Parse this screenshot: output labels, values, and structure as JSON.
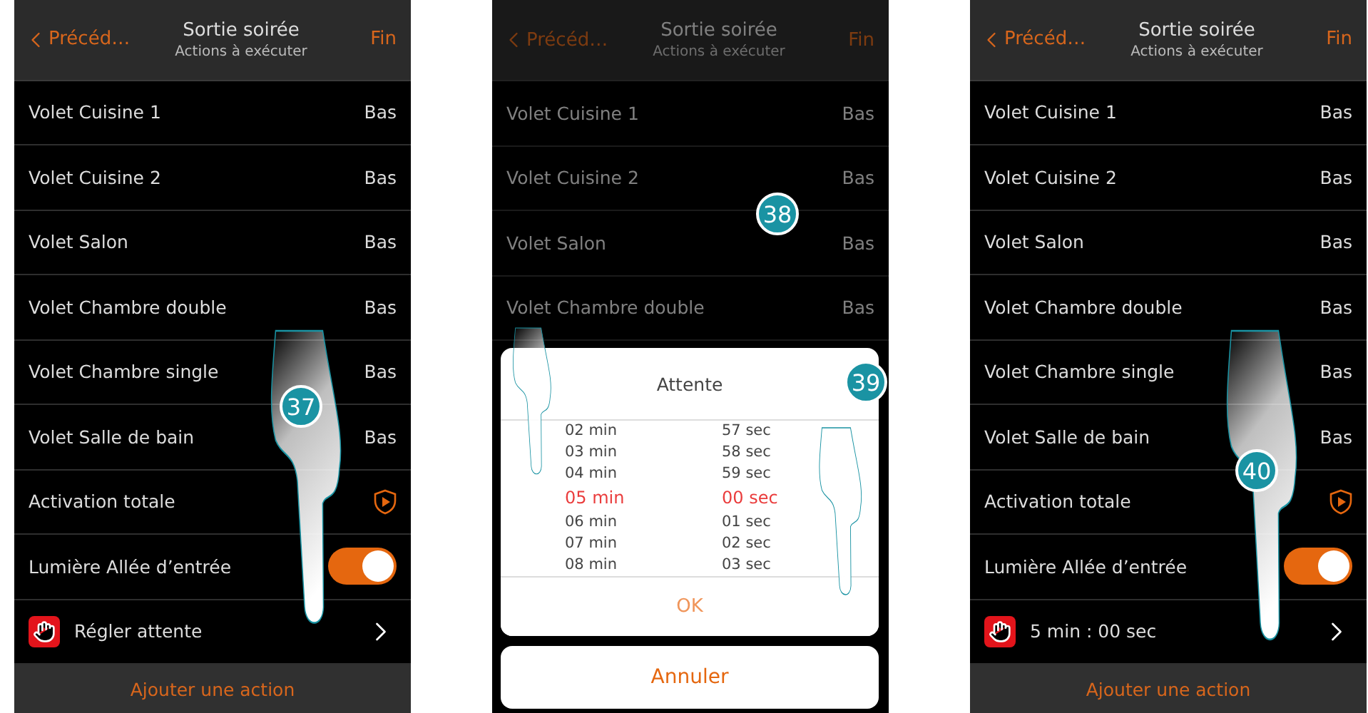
{
  "screens": [
    {
      "header": {
        "back": "Précéd…",
        "title": "Sortie soirée",
        "subtitle": "Actions à exécuter",
        "action": "Fin"
      },
      "dimmed": false,
      "steps": [
        {
          "label": "37"
        }
      ],
      "rows": [
        {
          "kind": "value",
          "label": "Volet Cuisine 1",
          "value": "Bas"
        },
        {
          "kind": "value",
          "label": "Volet Cuisine 2",
          "value": "Bas"
        },
        {
          "kind": "value",
          "label": "Volet Salon",
          "value": "Bas"
        },
        {
          "kind": "value",
          "label": "Volet Chambre double",
          "value": "Bas"
        },
        {
          "kind": "value",
          "label": "Volet Chambre single",
          "value": "Bas"
        },
        {
          "kind": "value",
          "label": "Volet Salle de bain",
          "value": "Bas"
        },
        {
          "kind": "scenario",
          "label": "Activation totale"
        },
        {
          "kind": "toggle",
          "label": "Lumière Allée d’entrée",
          "on": true
        },
        {
          "kind": "wait",
          "label": "Régler attente"
        }
      ],
      "footer": "Ajouter une action"
    },
    {
      "header": {
        "back": "Précéd…",
        "title": "Sortie soirée",
        "subtitle": "Actions à exécuter",
        "action": "Fin"
      },
      "dimmed": true,
      "steps": [
        {
          "label": "38"
        },
        {
          "label": "39"
        }
      ],
      "rows": [
        {
          "kind": "value",
          "label": "Volet Cuisine 1",
          "value": "Bas"
        },
        {
          "kind": "value",
          "label": "Volet Cuisine 2",
          "value": "Bas"
        },
        {
          "kind": "value",
          "label": "Volet Salon",
          "value": "Bas"
        },
        {
          "kind": "value",
          "label": "Volet Chambre double",
          "value": "Bas"
        }
      ],
      "dialog": {
        "title": "Attente",
        "minutes": [
          {
            "label": "02 min",
            "selected": false
          },
          {
            "label": "03 min",
            "selected": false
          },
          {
            "label": "04 min",
            "selected": false
          },
          {
            "label": "05 min",
            "selected": true
          },
          {
            "label": "06 min",
            "selected": false
          },
          {
            "label": "07 min",
            "selected": false
          },
          {
            "label": "08 min",
            "selected": false
          }
        ],
        "seconds": [
          {
            "label": "57 sec",
            "selected": false
          },
          {
            "label": "58 sec",
            "selected": false
          },
          {
            "label": "59 sec",
            "selected": false
          },
          {
            "label": "00 sec",
            "selected": true
          },
          {
            "label": "01 sec",
            "selected": false
          },
          {
            "label": "02 sec",
            "selected": false
          },
          {
            "label": "03 sec",
            "selected": false
          }
        ],
        "ok": "OK",
        "cancel": "Annuler"
      }
    },
    {
      "header": {
        "back": "Précéd…",
        "title": "Sortie soirée",
        "subtitle": "Actions à exécuter",
        "action": "Fin"
      },
      "dimmed": false,
      "steps": [
        {
          "label": "40"
        }
      ],
      "rows": [
        {
          "kind": "value",
          "label": "Volet Cuisine 1",
          "value": "Bas"
        },
        {
          "kind": "value",
          "label": "Volet Cuisine 2",
          "value": "Bas"
        },
        {
          "kind": "value",
          "label": "Volet Salon",
          "value": "Bas"
        },
        {
          "kind": "value",
          "label": "Volet Chambre double",
          "value": "Bas"
        },
        {
          "kind": "value",
          "label": "Volet Chambre single",
          "value": "Bas"
        },
        {
          "kind": "value",
          "label": "Volet Salle de bain",
          "value": "Bas"
        },
        {
          "kind": "scenario",
          "label": "Activation totale"
        },
        {
          "kind": "toggle",
          "label": "Lumière Allée d’entrée",
          "on": true
        },
        {
          "kind": "wait",
          "label": "5 min : 00 sec"
        }
      ],
      "footer": "Ajouter une action"
    }
  ]
}
